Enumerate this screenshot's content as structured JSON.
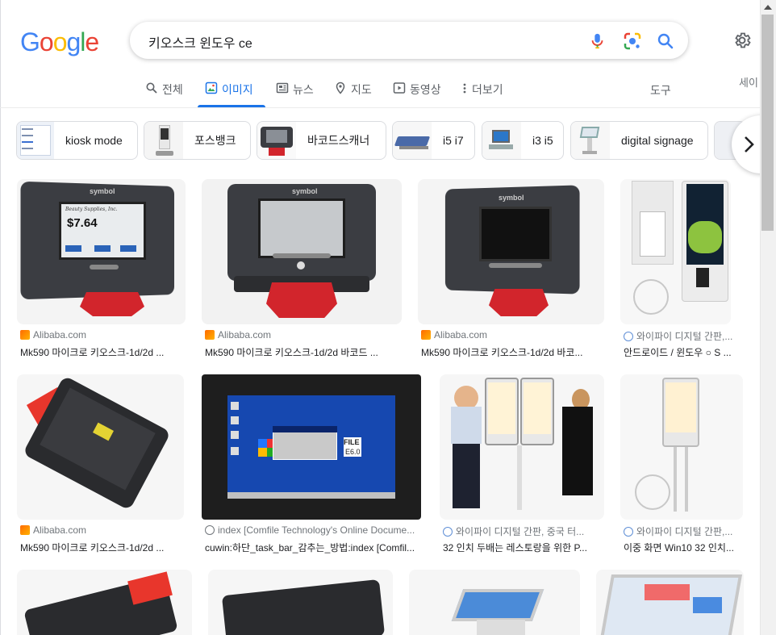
{
  "brand": {
    "letters": [
      "G",
      "o",
      "o",
      "g",
      "l",
      "e"
    ],
    "colors": [
      "#4285F4",
      "#EA4335",
      "#FBBC05",
      "#4285F4",
      "#34A853",
      "#EA4335"
    ]
  },
  "search": {
    "query": "키오스크 윈도우 ce"
  },
  "tabs": [
    {
      "label": "전체",
      "icon": "search-icon"
    },
    {
      "label": "이미지",
      "icon": "image-icon",
      "active": true
    },
    {
      "label": "뉴스",
      "icon": "news-icon"
    },
    {
      "label": "지도",
      "icon": "map-pin-icon"
    },
    {
      "label": "동영상",
      "icon": "video-icon"
    },
    {
      "label": "더보기",
      "icon": "more-vert-icon"
    }
  ],
  "tools_label": "도구",
  "safesearch_label": "세이",
  "chips": [
    {
      "label": "kiosk mode"
    },
    {
      "label": "포스뱅크"
    },
    {
      "label": "바코드스캐너"
    },
    {
      "label": "i5 i7"
    },
    {
      "label": "i3 i5"
    },
    {
      "label": "digital signage"
    }
  ],
  "results": [
    {
      "source": "Alibaba.com",
      "title": "Mk590 마이크로 키오스크-1d/2d ...",
      "fav": "ali"
    },
    {
      "source": "Alibaba.com",
      "title": "Mk590 마이크로 키오스크-1d/2d 바코드 ...",
      "fav": "ali"
    },
    {
      "source": "Alibaba.com",
      "title": "Mk590 마이크로 키오스크-1d/2d 바코...",
      "fav": "ali"
    },
    {
      "source": "와이파이 디지털 간판,...",
      "title": "안드로이드 / 윈도우 ○ S ...",
      "fav": "globe"
    },
    {
      "source": "Alibaba.com",
      "title": "Mk590 마이크로 키오스크-1d/2d ...",
      "fav": "ali"
    },
    {
      "source": "index [Comfile Technology's Online Docume...",
      "title": "cuwin:하단_task_bar_감추는_방법:index [Comfil...",
      "fav": "grey"
    },
    {
      "source": "와이파이 디지털 간판, 중국 터...",
      "title": "32 인치 두배는 레스토랑을 위한 P...",
      "fav": "globe"
    },
    {
      "source": "와이파이 디지털 간판,...",
      "title": "이중 화면 Win10 32 인치...",
      "fav": "globe"
    }
  ],
  "image_text": {
    "brand_symbol": "symbol",
    "price": "$7.64",
    "store": "Beauty Supplies, Inc.",
    "file_label": "FILE",
    "file_ver": "E6.0"
  }
}
